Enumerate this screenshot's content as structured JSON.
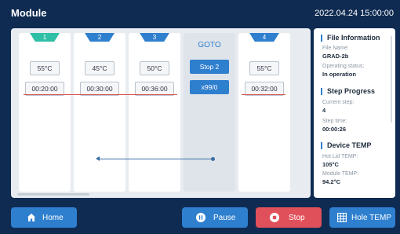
{
  "header": {
    "title": "Module",
    "datetime": "2022.04.24 15:00:00"
  },
  "steps": [
    {
      "number": "1",
      "temp": "55°C",
      "time": "00:20:00"
    },
    {
      "number": "2",
      "temp": "45°C",
      "time": "00:30:00"
    },
    {
      "number": "3",
      "temp": "50°C",
      "time": "00:36:00"
    },
    {
      "number": "4",
      "temp": "55°C",
      "time": "00:32:00"
    }
  ],
  "goto": {
    "label": "GOTO",
    "target": "Stop 2",
    "repeat": "x99/0"
  },
  "info": {
    "file_section": "File Information",
    "file_name_label": "File Name:",
    "file_name": "GRAD-2b",
    "status_label": "Operating status:",
    "status": "In operation",
    "progress_section": "Step Progress",
    "current_step_label": "Current step:",
    "current_step": "4",
    "step_time_label": "Step time:",
    "step_time": "00:00:26",
    "device_section": "Device TEMP",
    "hot_lid_label": "Hot Lid  TEMP:",
    "hot_lid": "105°C",
    "module_label": "Module  TEMP:",
    "module": "94.2°C"
  },
  "buttons": {
    "home": "Home",
    "pause": "Pause",
    "stop": "Stop",
    "hole_temp": "Hole TEMP"
  },
  "colors": {
    "background": "#0f2b52",
    "accent": "#2f7fcf",
    "stop": "#e0505a",
    "step1_tab": "#2fbfa6"
  },
  "icons": {
    "home": "home-icon",
    "pause": "pause-icon",
    "stop": "stop-icon",
    "hole_temp": "grid-icon"
  }
}
